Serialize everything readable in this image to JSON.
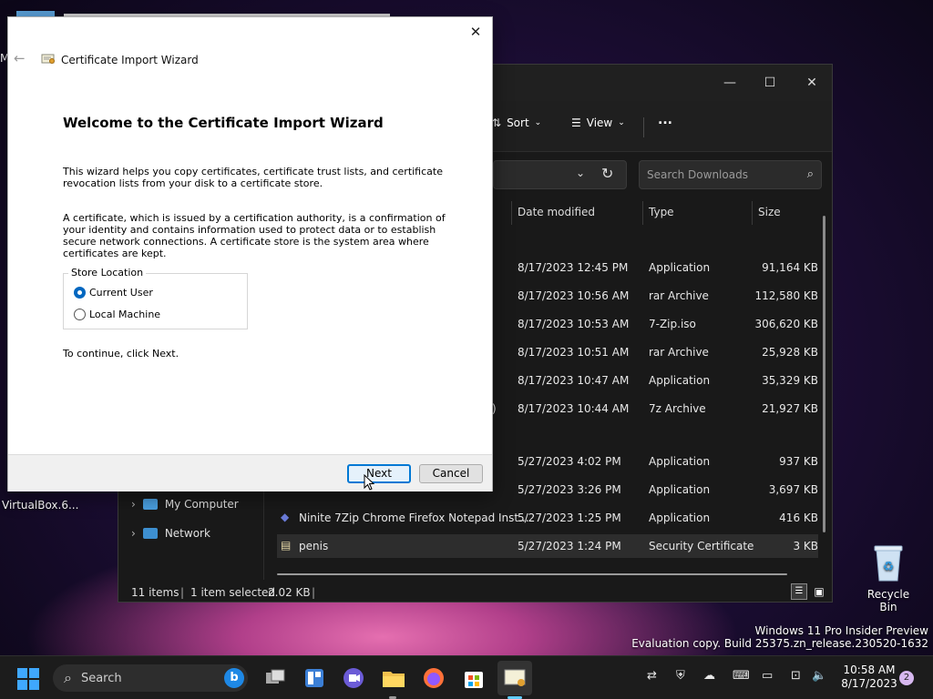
{
  "desktop": {
    "left_label_partial": "M",
    "virtualbox_label": "VirtualBox.6...",
    "recycle_bin_label": "Recycle Bin",
    "watermark_line1": "Windows 11 Pro Insider Preview",
    "watermark_line2": "Evaluation copy. Build 25375.zn_release.230520-1632"
  },
  "explorer": {
    "toolbar": {
      "sort_label": "Sort",
      "view_label": "View",
      "more_label": "..."
    },
    "search_placeholder": "Search Downloads",
    "columns": {
      "date": "Date modified",
      "type": "Type",
      "size": "Size"
    },
    "nav": {
      "computer": "My Computer",
      "network": "Network"
    },
    "rows": [
      {
        "name": "",
        "date": "8/17/2023 12:45 PM",
        "type": "Application",
        "size": "91,164 KB"
      },
      {
        "name": "",
        "date": "8/17/2023 10:56 AM",
        "type": "rar Archive",
        "size": "112,580 KB"
      },
      {
        "name": "",
        "date": "8/17/2023 10:53 AM",
        "type": "7-Zip.iso",
        "size": "306,620 KB"
      },
      {
        "name": "",
        "date": "8/17/2023 10:51 AM",
        "type": "rar Archive",
        "size": "25,928 KB"
      },
      {
        "name": "",
        "date": "8/17/2023 10:47 AM",
        "type": "Application",
        "size": "35,329 KB"
      },
      {
        "name": ")",
        "date": "8/17/2023 10:44 AM",
        "type": "7z Archive",
        "size": "21,927 KB"
      },
      {
        "name": "",
        "date": "5/27/2023 4:02 PM",
        "type": "Application",
        "size": "937 KB"
      },
      {
        "name": "",
        "date": "5/27/2023 3:26 PM",
        "type": "Application",
        "size": "3,697 KB"
      },
      {
        "name": "Ninite 7Zip Chrome Firefox Notepad Inst...",
        "date": "5/27/2023 1:25 PM",
        "type": "Application",
        "size": "416 KB"
      },
      {
        "name": "penis",
        "date": "5/27/2023 1:24 PM",
        "type": "Security Certificate",
        "size": "3 KB"
      }
    ],
    "status": {
      "items": "11 items",
      "selected": "1 item selected",
      "selected_size": "2.02 KB"
    }
  },
  "wizard": {
    "window_title": "Certificate Import Wizard",
    "heading": "Welcome to the Certificate Import Wizard",
    "para1": "This wizard helps you copy certificates, certificate trust lists, and certificate revocation lists from your disk to a certificate store.",
    "para2": "A certificate, which is issued by a certification authority, is a confirmation of your identity and contains information used to protect data or to establish secure network connections. A certificate store is the system area where certificates are kept.",
    "store_location_label": "Store Location",
    "option_current_user": "Current User",
    "option_local_machine": "Local Machine",
    "selected_option": "Current User",
    "continue_text": "To continue, click Next.",
    "next_label": "Next",
    "cancel_label": "Cancel"
  },
  "taskbar": {
    "search_label": "Search",
    "time": "10:58 AM",
    "date": "8/17/2023",
    "notification_count": "2"
  },
  "colors": {
    "accent": "#0078d4",
    "explorer_bg": "#191919",
    "taskbar_bg": "#1c1c1c"
  }
}
